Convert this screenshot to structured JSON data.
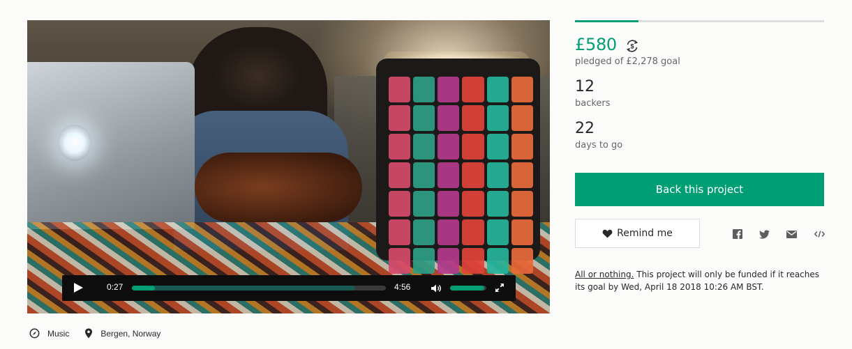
{
  "video": {
    "current_time": "0:27",
    "duration": "4:56",
    "played_fraction": 0.0912,
    "buffered_fraction": 0.88,
    "volume_fraction": 0.95
  },
  "meta": {
    "category": "Music",
    "category_icon": "compass-icon",
    "location": "Bergen, Norway",
    "location_icon": "map-pin-icon"
  },
  "funding": {
    "progress_fraction": 0.2546,
    "pledged": "£580",
    "pledged_label": "pledged of £2,278 goal",
    "backers": "12",
    "backers_label": "backers",
    "days": "22",
    "days_label": "days to go"
  },
  "actions": {
    "back_label": "Back this project",
    "remind_label": "Remind me"
  },
  "share": [
    "facebook-icon",
    "twitter-icon",
    "email-icon",
    "embed-icon"
  ],
  "note": {
    "link": "All or nothing.",
    "text": " This project will only be funded if it reaches its goal by Wed, April 18 2018 10:26 AM BST."
  },
  "colors": {
    "accent": "#009e74",
    "text": "#282828",
    "muted": "#656969",
    "background": "#fbfbfa"
  }
}
